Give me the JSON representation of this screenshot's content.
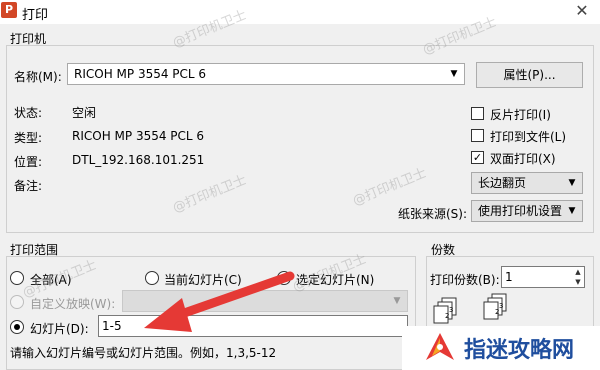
{
  "window": {
    "title": "打印",
    "app_icon_letter": "P"
  },
  "printer": {
    "group_title": "打印机",
    "name_label": "名称(M):",
    "name_value": "RICOH MP 3554 PCL 6",
    "properties_button": "属性(P)...",
    "status_label": "状态:",
    "status_value": "空闲",
    "type_label": "类型:",
    "type_value": "RICOH MP 3554 PCL 6",
    "location_label": "位置:",
    "location_value": "DTL_192.168.101.251",
    "comment_label": "备注:",
    "reverse_print": {
      "label": "反片打印(I)",
      "checked": false
    },
    "print_to_file": {
      "label": "打印到文件(L)",
      "checked": false
    },
    "duplex": {
      "label": "双面打印(X)",
      "checked": true
    },
    "duplex_mode": "长边翻页",
    "paper_source_label": "纸张来源(S):",
    "paper_source_value": "使用打印机设置"
  },
  "print_range": {
    "group_title": "打印范围",
    "all": "全部(A)",
    "current": "当前幻灯片(C)",
    "selected": "选定幻灯片(N)",
    "custom_show": "自定义放映(W):",
    "slides_label": "幻灯片(D):",
    "slides_value": "1-5",
    "selected_option": "slides",
    "hint": "请输入幻灯片编号或幻灯片范围。例如，1,3,5-12"
  },
  "copies": {
    "group_title": "份数",
    "count_label": "打印份数(B):",
    "count_value": "1"
  },
  "watermark_text": "@打印机卫士",
  "brand": {
    "name": "指迷攻略网"
  },
  "colors": {
    "arrow": "#e53935",
    "brand": "#1f4e9e",
    "app_icon": "#d24726"
  }
}
